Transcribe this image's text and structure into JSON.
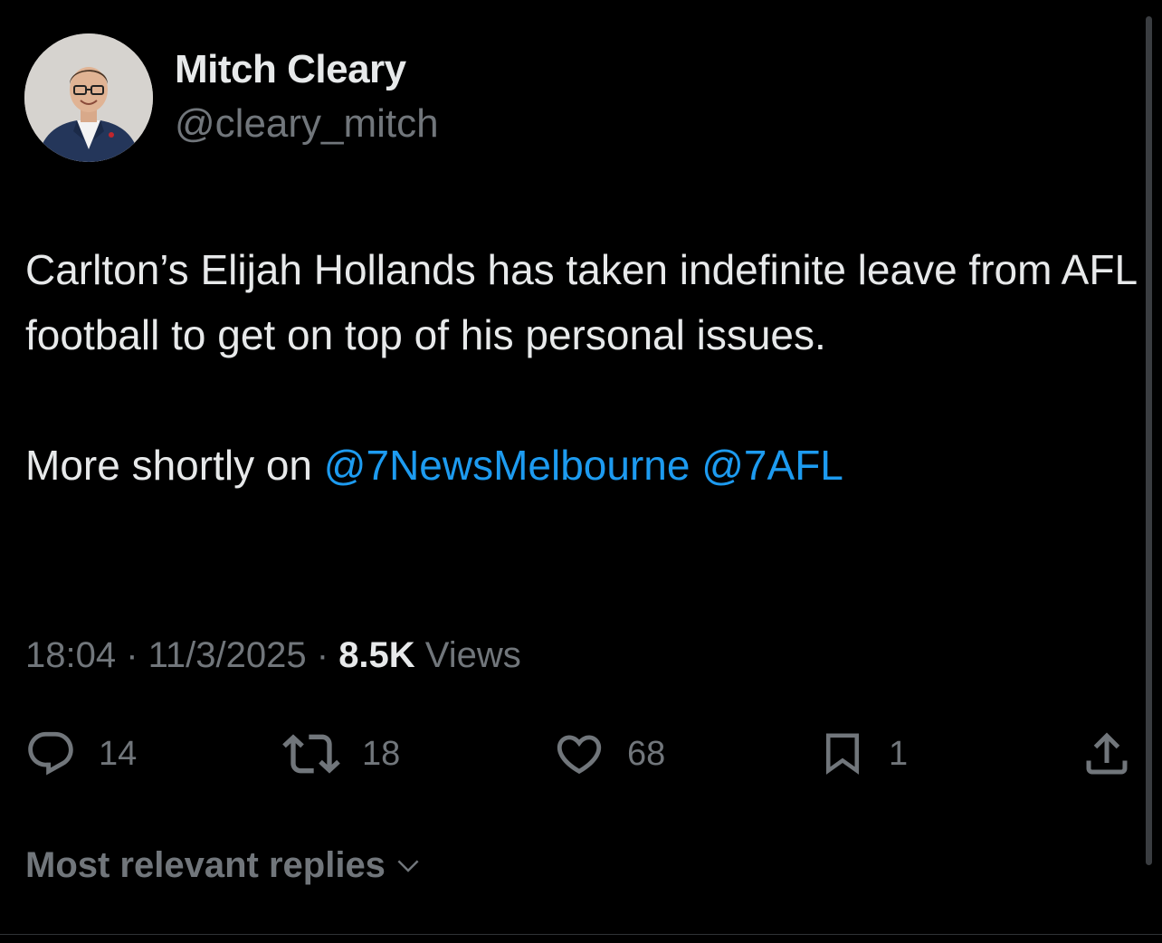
{
  "author": {
    "display_name": "Mitch Cleary",
    "handle": "@cleary_mitch",
    "avatar_icon": "profile-photo"
  },
  "tweet": {
    "lines": [
      "Carlton’s Elijah Hollands has taken indefinite leave from AFL football to get on top of his personal issues."
    ],
    "more_text": "More shortly on ",
    "mention_1": "@7NewsMelbourne",
    "mention_2": "@7AFL",
    "time": "18:04",
    "date": "11/3/2025",
    "separator": " · ",
    "views_count": "8.5K",
    "views_label": " Views"
  },
  "actions": {
    "reply": {
      "icon": "reply-icon",
      "count": "14"
    },
    "repost": {
      "icon": "repost-icon",
      "count": "18"
    },
    "like": {
      "icon": "heart-icon",
      "count": "68"
    },
    "bookmark": {
      "icon": "bookmark-icon",
      "count": "1"
    },
    "share": {
      "icon": "share-icon"
    }
  },
  "replies": {
    "sort_label": "Most relevant replies",
    "icon": "chevron-down-icon"
  },
  "colors": {
    "background": "#000000",
    "primary_text": "#e7e9ea",
    "secondary_text": "#71767b",
    "accent": "#1d9bf0"
  }
}
